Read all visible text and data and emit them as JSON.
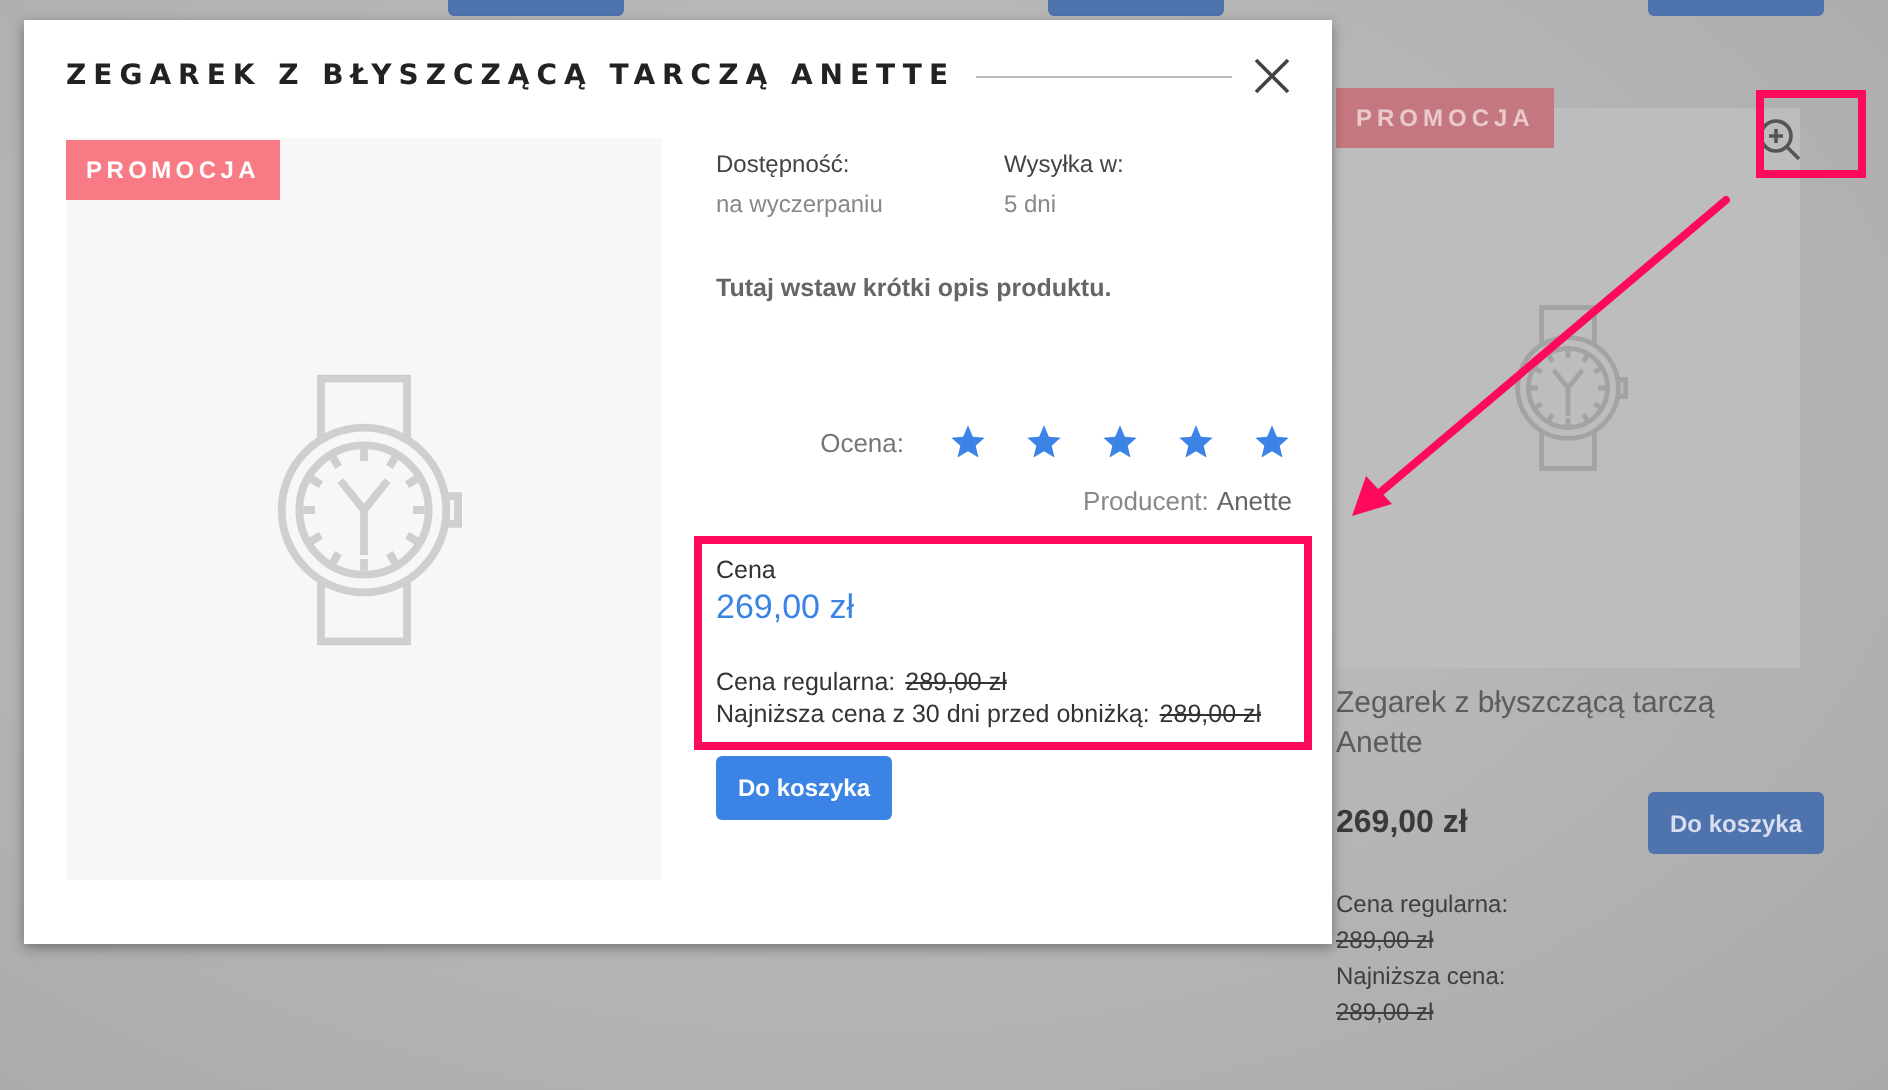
{
  "background_product": {
    "badge": "PROMOCJA",
    "title": "Zegarek z błyszczącą tarczą Anette",
    "price": "269,00 zł",
    "button": "Do koszyka",
    "regular_price_label": "Cena regularna:",
    "regular_price": "289,00 zł",
    "lowest_price_label": "Najniższa cena:",
    "lowest_price": "289,00 zł"
  },
  "modal": {
    "title": "ZEGAREK Z BŁYSZCZĄCĄ TARCZĄ ANETTE",
    "badge": "PROMOCJA",
    "availability_label": "Dostępność:",
    "availability": "na wyczerpaniu",
    "shipping_label": "Wysyłka w:",
    "shipping": "5 dni",
    "description": "Tutaj wstaw krótki opis produktu.",
    "rating_label": "Ocena:",
    "stars": 5,
    "producer_label": "Producent:",
    "producer": "Anette",
    "price_label": "Cena",
    "price": "269,00 zł",
    "regular_price_label": "Cena regularna:",
    "regular_price": "289,00 zł",
    "lowest_price_label": "Najniższa cena z 30 dni przed obniżką:",
    "lowest_price": "289,00 zł",
    "button": "Do koszyka"
  }
}
